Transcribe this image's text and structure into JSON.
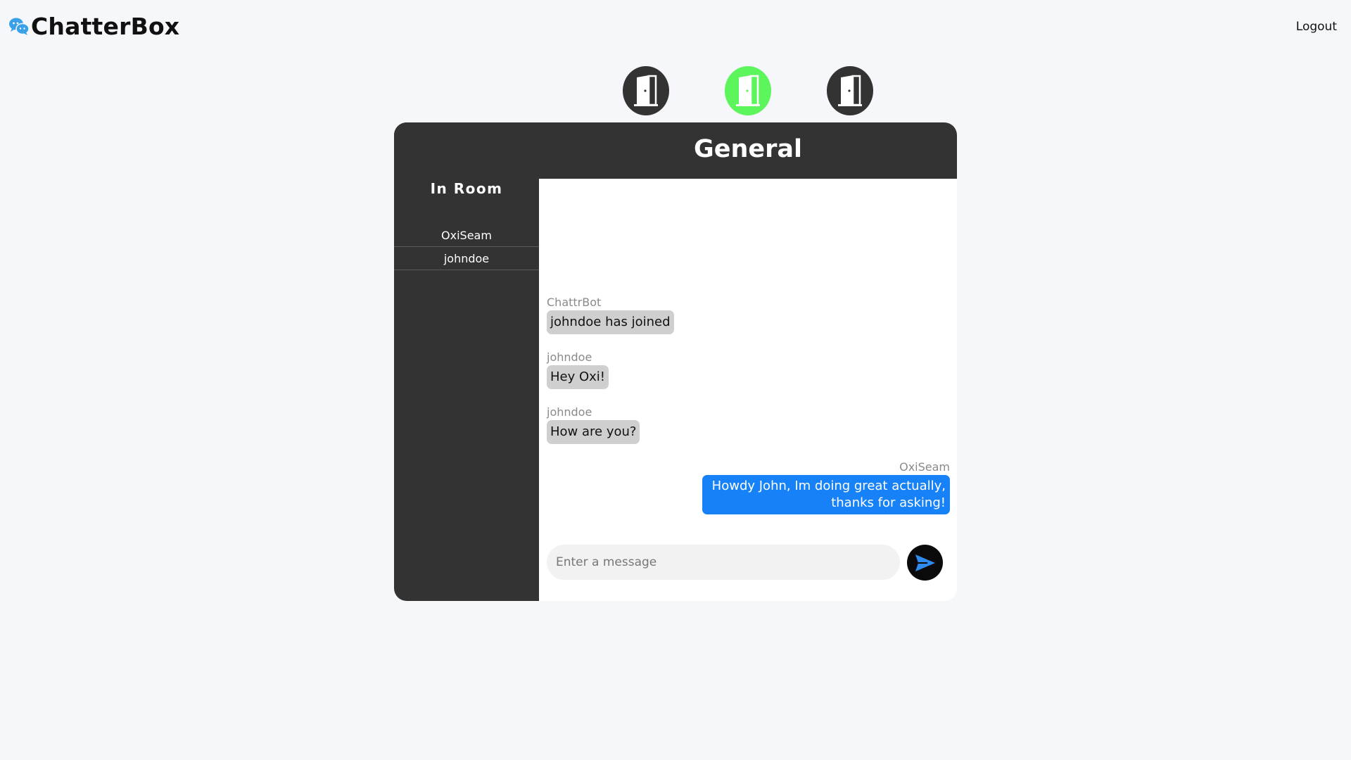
{
  "app": {
    "name": "ChatterBox",
    "logo_icon": "chat-bubbles-icon",
    "brand_color": "#3aa0e8"
  },
  "nav": {
    "logout_label": "Logout"
  },
  "rooms": {
    "items": [
      {
        "icon": "door-icon",
        "active": false,
        "color": "#333333"
      },
      {
        "icon": "door-icon",
        "active": true,
        "color": "#5cf55c"
      },
      {
        "icon": "door-icon",
        "active": false,
        "color": "#333333"
      }
    ]
  },
  "chat": {
    "room_title": "General",
    "sidebar": {
      "title": "In Room",
      "users": [
        "OxiSeam",
        "johndoe"
      ]
    },
    "messages": [
      {
        "sender": "ChattrBot",
        "text": "johndoe has joined",
        "own": false
      },
      {
        "sender": "johndoe",
        "text": "Hey Oxi!",
        "own": false
      },
      {
        "sender": "johndoe",
        "text": "How are you?",
        "own": false
      },
      {
        "sender": "OxiSeam",
        "text_line1": "Howdy John, Im doing great actually,",
        "text_line2": "thanks for asking!",
        "own": true
      }
    ],
    "composer": {
      "placeholder": "Enter a message",
      "value": "",
      "send_icon": "send-icon"
    },
    "colors": {
      "panel": "#333333",
      "own_bubble": "#1781f8",
      "other_bubble": "#cfcfcf"
    }
  }
}
